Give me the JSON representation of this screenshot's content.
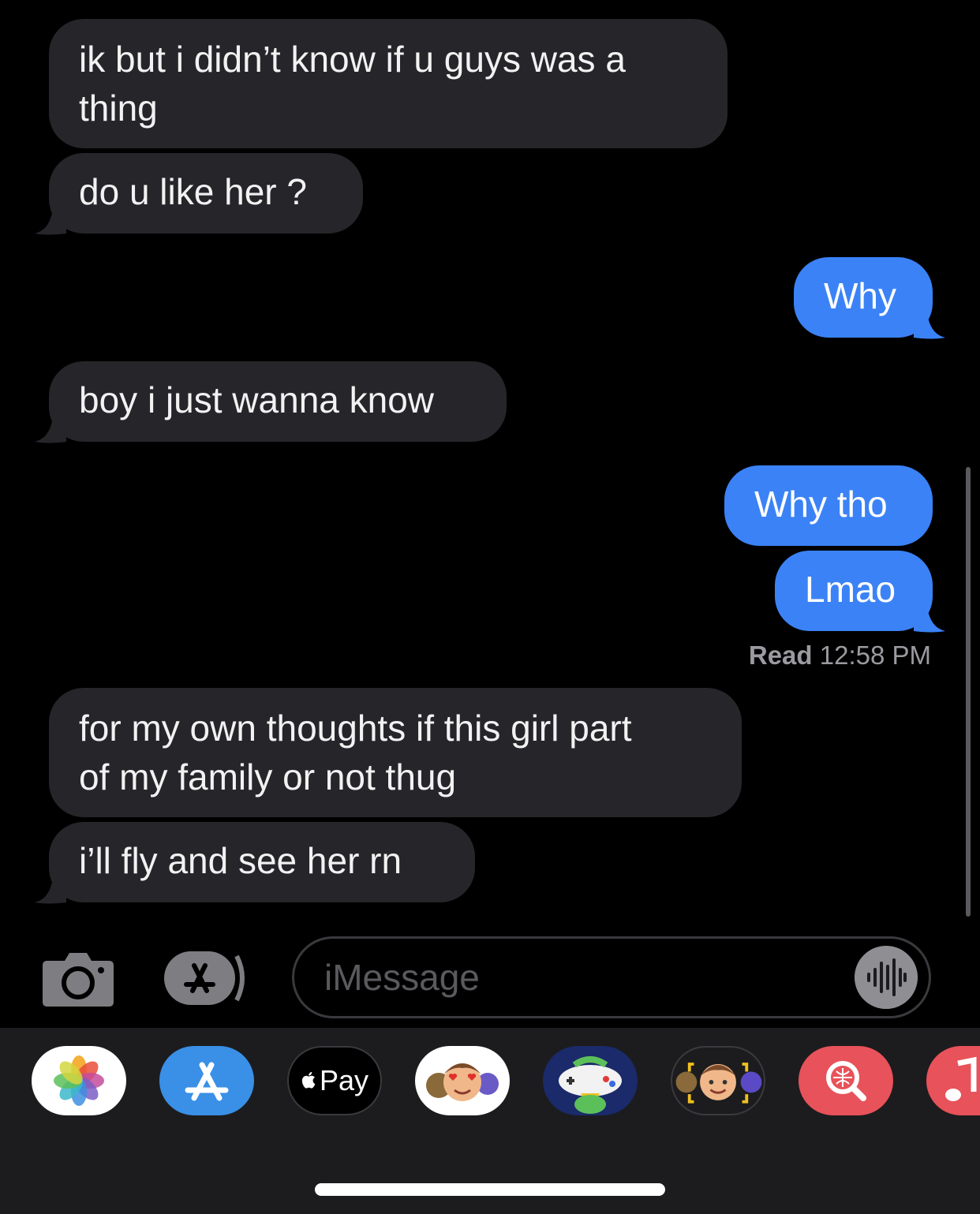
{
  "messages": [
    {
      "from": "them",
      "text_lines": [
        "ik but i didn’t know if u guys was a",
        "thing"
      ]
    },
    {
      "from": "them",
      "text": "do u like her ?"
    },
    {
      "from": "me",
      "text": "Why"
    },
    {
      "from": "them",
      "text": "boy i just wanna know"
    },
    {
      "from": "me",
      "text": "Why tho"
    },
    {
      "from": "me",
      "text": "Lmao"
    },
    {
      "from": "them",
      "text_lines": [
        "for my own thoughts if this girl part",
        "of my family or not thug"
      ]
    },
    {
      "from": "them",
      "text": "i’ll fly and see her rn"
    }
  ],
  "read_receipt": {
    "label": "Read",
    "time": "12:58 PM"
  },
  "input": {
    "placeholder": "iMessage"
  },
  "app_tray": {
    "items": [
      "photos-icon",
      "app-store-icon",
      "apple-pay-icon",
      "memoji-stickers-icon",
      "game-pigeon-icon",
      "memoji-icon",
      "web-search-icon",
      "music-icon"
    ],
    "apple_pay_label": "Pay"
  },
  "colors": {
    "sent": "#3b82f6",
    "received": "#26262a",
    "background": "#000000"
  }
}
